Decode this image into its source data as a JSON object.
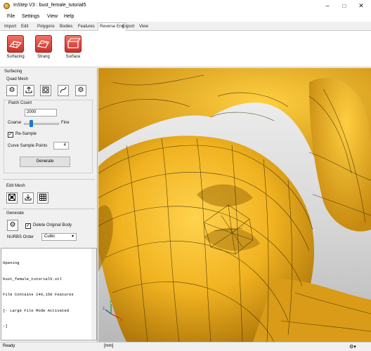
{
  "window": {
    "title": "InStep V3 : bust_female_tutorial5"
  },
  "menu": [
    "File",
    "Settings",
    "View",
    "Help"
  ],
  "tabs": [
    "Import",
    "Edit",
    "Polygons",
    "Bodies",
    "Features",
    "Reverse Eng",
    "Export",
    "View"
  ],
  "active_tab": "Reverse Eng",
  "ribbon": {
    "buttons": [
      "Surfacing",
      "Strang",
      "Surface"
    ]
  },
  "panel": {
    "title": "Surfacing",
    "quad_mesh": {
      "label": "Quad Mesh",
      "patch_count_label": "Patch Count",
      "patch_count_value": "2000",
      "coarse_label": "Coarse",
      "fine_label": "Fine",
      "slider_level": 0.18,
      "resample_label": "Re-Sample",
      "resample_checked": true,
      "curve_sample_label": "Curve Sample Points",
      "curve_sample_value": "4",
      "generate_label": "Generate"
    },
    "edit_mesh": {
      "label": "Edit Mesh"
    },
    "generate": {
      "label": "Generate",
      "delete_label": "Delete Original Body",
      "delete_checked": true,
      "nurbs_label": "NURBS Order",
      "nurbs_value": "Cubic"
    }
  },
  "console_lines": [
    "Opening",
    "bust_female_tutorial5.stl",
    "File Contains 149,150 Features",
    "[- Large File Mode Activated",
    "-]"
  ],
  "status": {
    "left": "Ready",
    "units": "[mm]"
  },
  "icons": [
    "app-icon",
    "minimize-icon",
    "maximize-icon",
    "close-icon",
    "gear-icon",
    "export-icon",
    "mesh-icon",
    "curve-icon",
    "settings-gear-icon",
    "cross-mesh-icon",
    "download-icon",
    "grid-icon",
    "axis-triad-icon"
  ],
  "colors": {
    "accent_red": "#d9403a",
    "model_gold": "#f1b320",
    "tab_active": "#ffffff"
  }
}
